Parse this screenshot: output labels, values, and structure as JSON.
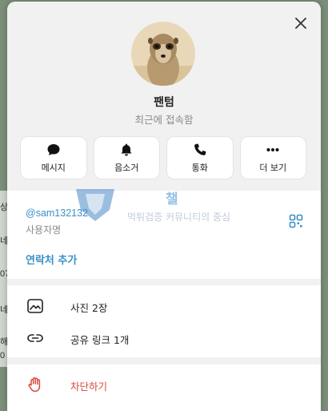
{
  "backdrop": {
    "peek_texts": [
      "상",
      "네",
      "07",
      "네",
      "해",
      "0"
    ]
  },
  "profile": {
    "name": "팬텀",
    "status": "최근에 접속함",
    "avatar_desc": "meerkat-photo"
  },
  "actions": [
    {
      "label": "메시지",
      "icon": "chat-bubble-icon"
    },
    {
      "label": "음소거",
      "icon": "bell-icon"
    },
    {
      "label": "통화",
      "icon": "phone-icon"
    },
    {
      "label": "더 보기",
      "icon": "more-dots-icon"
    }
  ],
  "info": {
    "username": "@sam132132",
    "username_caption": "사용자명",
    "add_contact": "연락처 추가"
  },
  "watermark": {
    "title": "챌",
    "subtitle": "먹튀검증 커뮤니티의 중심"
  },
  "media": [
    {
      "label": "사진 2장",
      "icon": "photo-icon"
    },
    {
      "label": "공유 링크 1개",
      "icon": "link-icon"
    }
  ],
  "block": {
    "label": "차단하기",
    "icon": "hand-block-icon"
  },
  "colors": {
    "accent": "#3a8fc8",
    "danger": "#d84a3b",
    "panel_bg": "#ffffff",
    "modal_bg": "#f1f1f1"
  }
}
